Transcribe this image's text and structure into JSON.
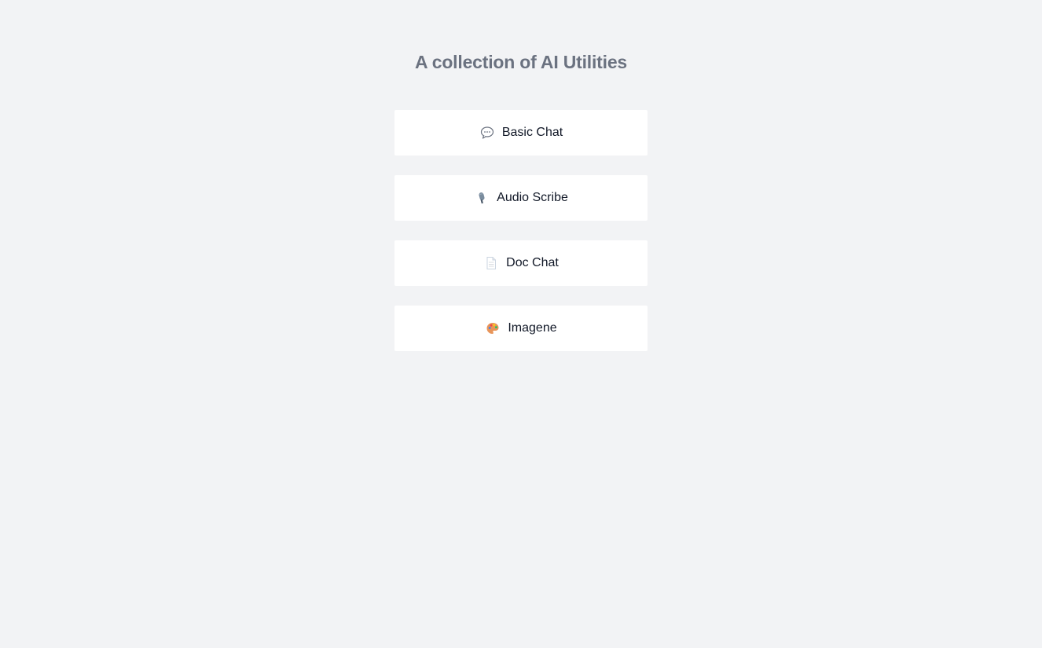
{
  "page": {
    "title": "A collection of AI Utilities",
    "background": "#f2f3f5"
  },
  "menu": {
    "items": [
      {
        "label": "Basic Chat",
        "icon": "speech-bubble-icon"
      },
      {
        "label": "Audio Scribe",
        "icon": "microphone-icon"
      },
      {
        "label": "Doc Chat",
        "icon": "document-icon"
      },
      {
        "label": "Imagene",
        "icon": "palette-icon"
      }
    ]
  }
}
